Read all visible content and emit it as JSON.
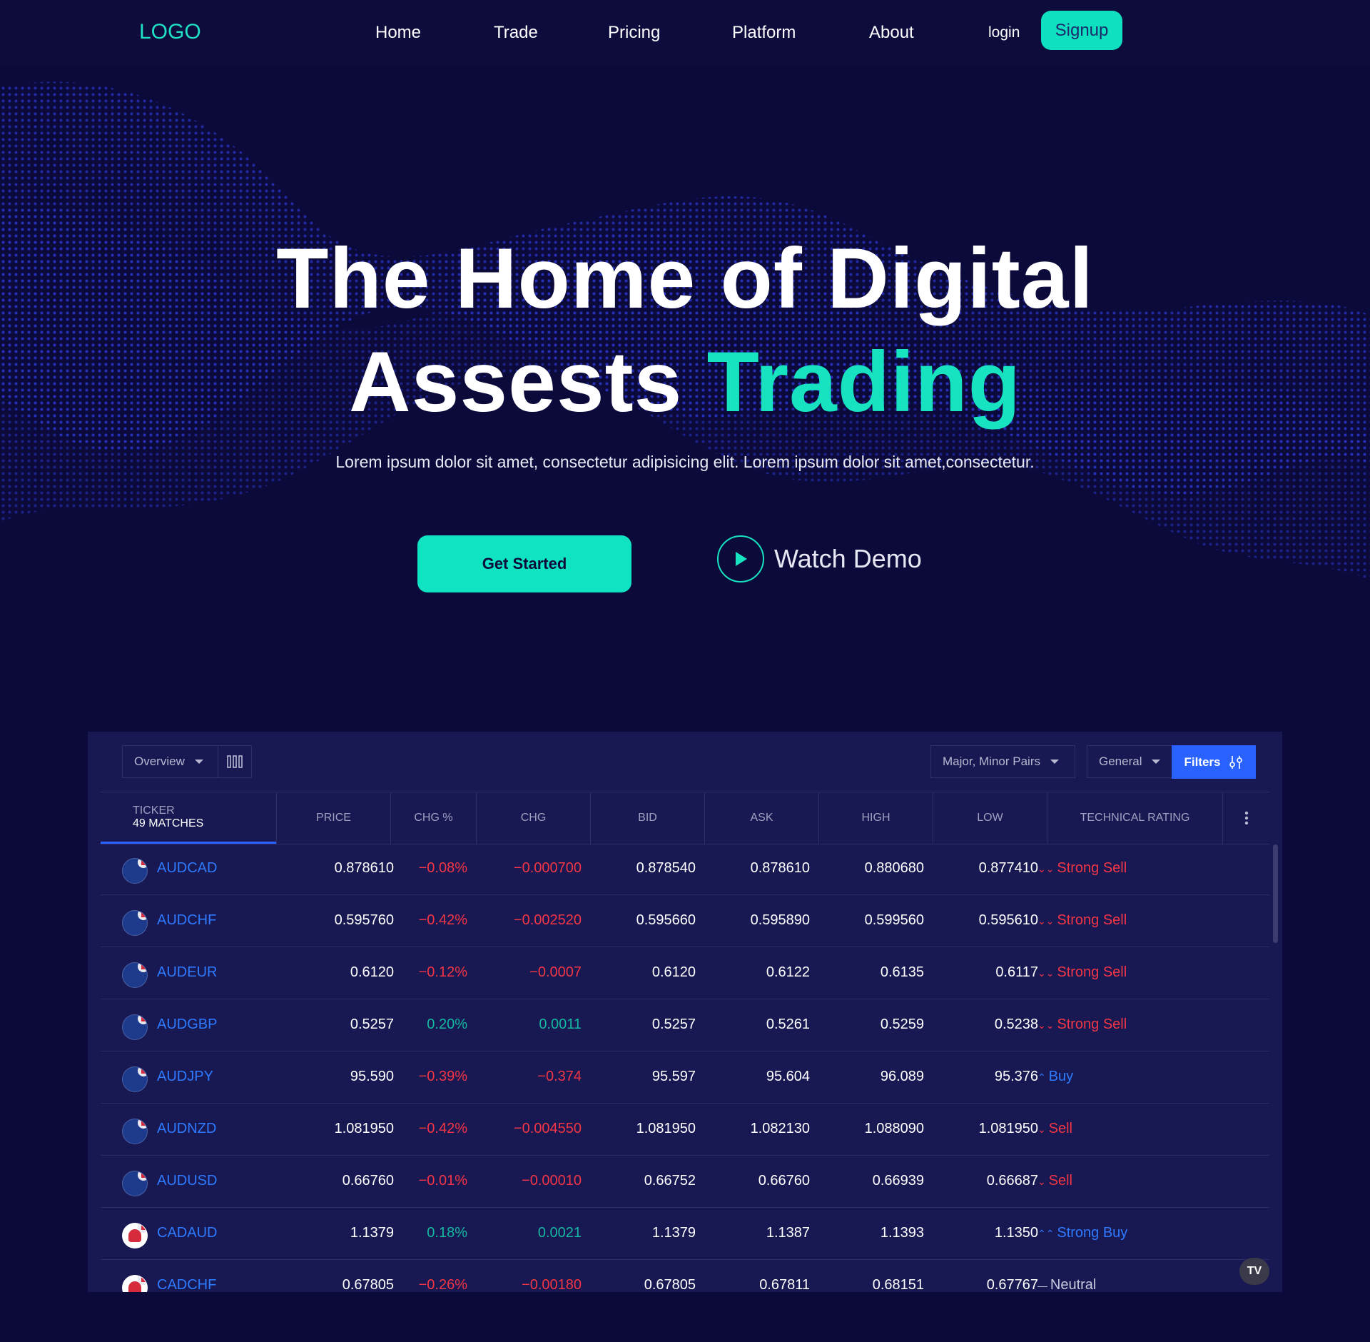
{
  "nav": {
    "logo": "LOGO",
    "links": [
      "Home",
      "Trade",
      "Pricing",
      "Platform",
      "About"
    ],
    "login": "login",
    "signup": "Signup"
  },
  "hero": {
    "title_line1": "The Home of Digital",
    "title_line2_a": "Assests",
    "title_line2_b": "Trading",
    "subtitle": "Lorem ipsum dolor sit amet, consectetur adipisicing elit. Lorem ipsum dolor sit amet,consectetur.",
    "cta": "Get Started",
    "demo": "Watch Demo"
  },
  "colors": {
    "accent": "#17e3c0",
    "background": "#0b0a3a",
    "table_bg": "#181853",
    "link": "#2f7bff",
    "negative": "#f23645",
    "positive": "#16b8a0"
  },
  "toolbar": {
    "view": "Overview",
    "market": "Major, Minor Pairs",
    "group": "General",
    "filters": "Filters"
  },
  "table": {
    "ticker_label": "TICKER",
    "matches": "49 MATCHES",
    "columns": [
      "PRICE",
      "CHG %",
      "CHG",
      "BID",
      "ASK",
      "HIGH",
      "LOW",
      "TECHNICAL RATING"
    ],
    "rows": [
      {
        "symbol": "AUDCAD",
        "price": "0.878610",
        "chgp": "−0.08%",
        "chg": "−0.000700",
        "bid": "0.878540",
        "ask": "0.878610",
        "high": "0.880680",
        "low": "0.877410",
        "rating": "Strong Sell",
        "dir": "neg",
        "rtype": "strong-sell",
        "flag": "au"
      },
      {
        "symbol": "AUDCHF",
        "price": "0.595760",
        "chgp": "−0.42%",
        "chg": "−0.002520",
        "bid": "0.595660",
        "ask": "0.595890",
        "high": "0.599560",
        "low": "0.595610",
        "rating": "Strong Sell",
        "dir": "neg",
        "rtype": "strong-sell",
        "flag": "au"
      },
      {
        "symbol": "AUDEUR",
        "price": "0.6120",
        "chgp": "−0.12%",
        "chg": "−0.0007",
        "bid": "0.6120",
        "ask": "0.6122",
        "high": "0.6135",
        "low": "0.6117",
        "rating": "Strong Sell",
        "dir": "neg",
        "rtype": "strong-sell",
        "flag": "au"
      },
      {
        "symbol": "AUDGBP",
        "price": "0.5257",
        "chgp": "0.20%",
        "chg": "0.0011",
        "bid": "0.5257",
        "ask": "0.5261",
        "high": "0.5259",
        "low": "0.5238",
        "rating": "Strong Sell",
        "dir": "pos",
        "rtype": "strong-sell",
        "flag": "au"
      },
      {
        "symbol": "AUDJPY",
        "price": "95.590",
        "chgp": "−0.39%",
        "chg": "−0.374",
        "bid": "95.597",
        "ask": "95.604",
        "high": "96.089",
        "low": "95.376",
        "rating": "Buy",
        "dir": "neg",
        "rtype": "buy",
        "flag": "au"
      },
      {
        "symbol": "AUDNZD",
        "price": "1.081950",
        "chgp": "−0.42%",
        "chg": "−0.004550",
        "bid": "1.081950",
        "ask": "1.082130",
        "high": "1.088090",
        "low": "1.081950",
        "rating": "Sell",
        "dir": "neg",
        "rtype": "sell",
        "flag": "au"
      },
      {
        "symbol": "AUDUSD",
        "price": "0.66760",
        "chgp": "−0.01%",
        "chg": "−0.00010",
        "bid": "0.66752",
        "ask": "0.66760",
        "high": "0.66939",
        "low": "0.66687",
        "rating": "Sell",
        "dir": "neg",
        "rtype": "sell",
        "flag": "au"
      },
      {
        "symbol": "CADAUD",
        "price": "1.1379",
        "chgp": "0.18%",
        "chg": "0.0021",
        "bid": "1.1379",
        "ask": "1.1387",
        "high": "1.1393",
        "low": "1.1350",
        "rating": "Strong Buy",
        "dir": "pos",
        "rtype": "strong-buy",
        "flag": "ca"
      },
      {
        "symbol": "CADCHF",
        "price": "0.67805",
        "chgp": "−0.26%",
        "chg": "−0.00180",
        "bid": "0.67805",
        "ask": "0.67811",
        "high": "0.68151",
        "low": "0.67767",
        "rating": "Neutral",
        "dir": "neg",
        "rtype": "neutral",
        "flag": "ca"
      }
    ]
  },
  "icons": [
    "columns-icon",
    "filters-icon",
    "play-icon",
    "more-vertical-icon",
    "tradingview-logo-icon"
  ],
  "watermark": "TV"
}
